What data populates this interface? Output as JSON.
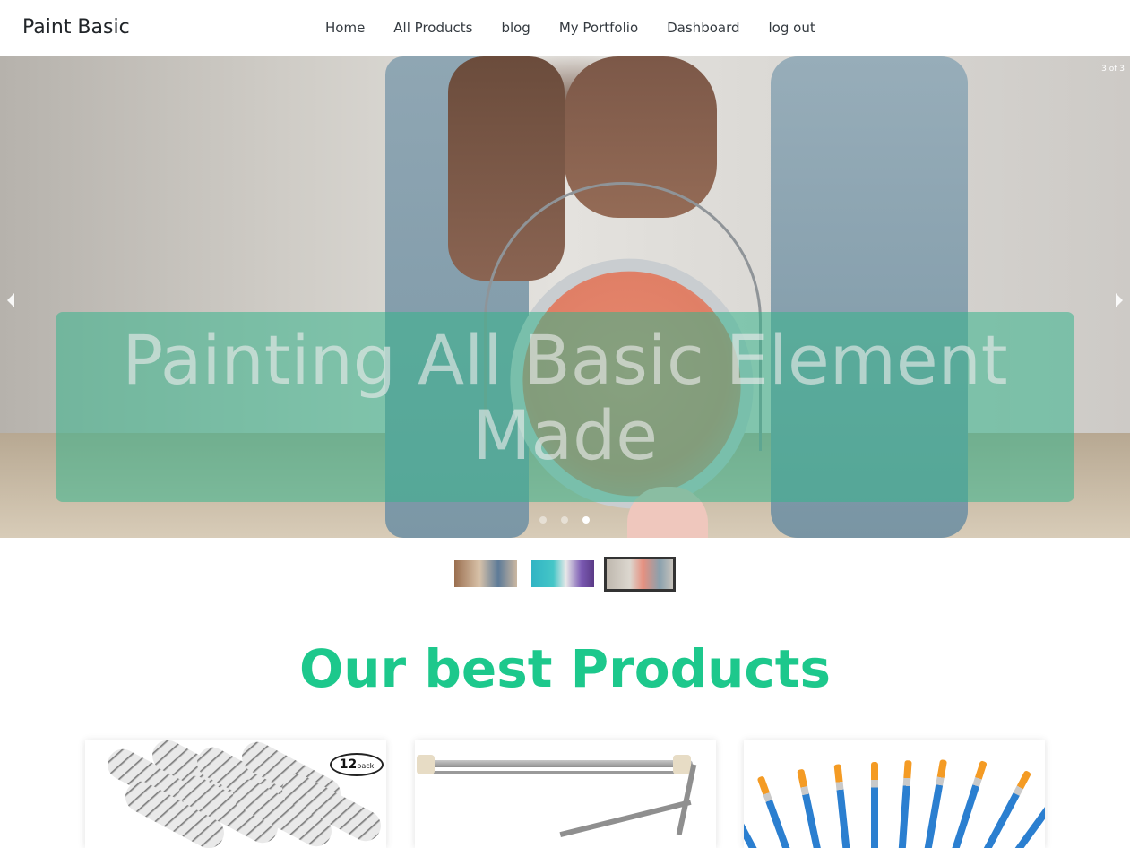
{
  "navbar": {
    "brand": "Paint Basic",
    "links": [
      "Home",
      "All Products",
      "blog",
      "My Portfolio",
      "Dashboard",
      "log out"
    ]
  },
  "carousel": {
    "counter": "3 of 3",
    "caption": "Painting All Basic Element Made",
    "slide_count": 3,
    "active_slide": 3,
    "prev_icon": "triangle-left-icon",
    "next_icon": "triangle-right-icon"
  },
  "thumbnails": [
    {
      "name": "thumbnail-painters"
    },
    {
      "name": "thumbnail-paint-brush-swatches"
    },
    {
      "name": "thumbnail-paint-can",
      "active": true
    }
  ],
  "products_section": {
    "title": "Our best Products",
    "badge_number": "12",
    "badge_text": "pack"
  },
  "colors": {
    "accent": "#1dc88c",
    "caption_overlay": "#36b48c",
    "text_dark": "#212529"
  }
}
